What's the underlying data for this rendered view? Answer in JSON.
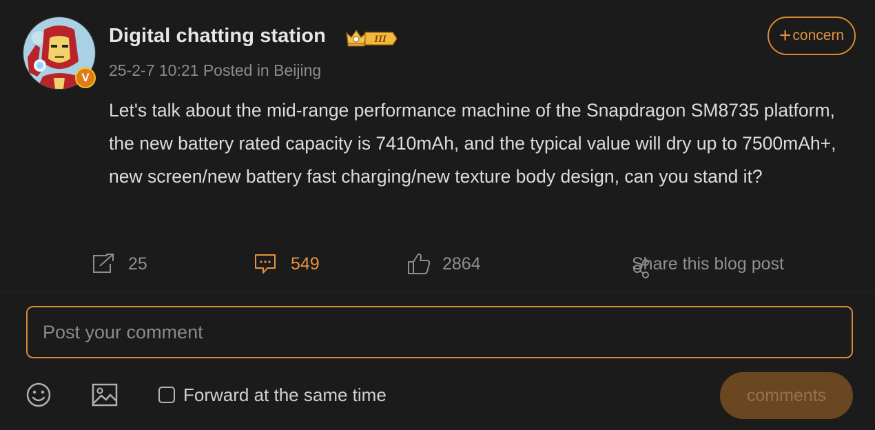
{
  "post": {
    "author": "Digital chatting station",
    "rank_badge": "III",
    "verified_mark": "V",
    "timestamp": "25-2-7 10:21",
    "location_text": "Posted in Beijing",
    "follow_label": "concern",
    "follow_plus": "+",
    "body": "Let's talk about the mid-range performance machine of the Snapdragon SM8735 platform, the new battery rated capacity is 7410mAh, and the typical value will dry up to 7500mAh+, new screen/new battery fast charging/new texture body design, can you stand it?"
  },
  "actions": {
    "reposts": "25",
    "comments": "549",
    "likes": "2864",
    "share_label": "Share this blog post"
  },
  "composer": {
    "placeholder": "Post your comment",
    "forward_label": "Forward at the same time",
    "forward_checked": false,
    "submit_label": "comments"
  },
  "colors": {
    "accent": "#d98a35",
    "background": "#1b1b1b",
    "muted": "#8c8c8c"
  },
  "icons": {
    "repost": "repost-icon",
    "comment": "comment-icon",
    "like": "thumbs-up-icon",
    "share": "share-icon",
    "emoji": "emoji-icon",
    "image": "image-icon",
    "crown": "crown-icon"
  }
}
